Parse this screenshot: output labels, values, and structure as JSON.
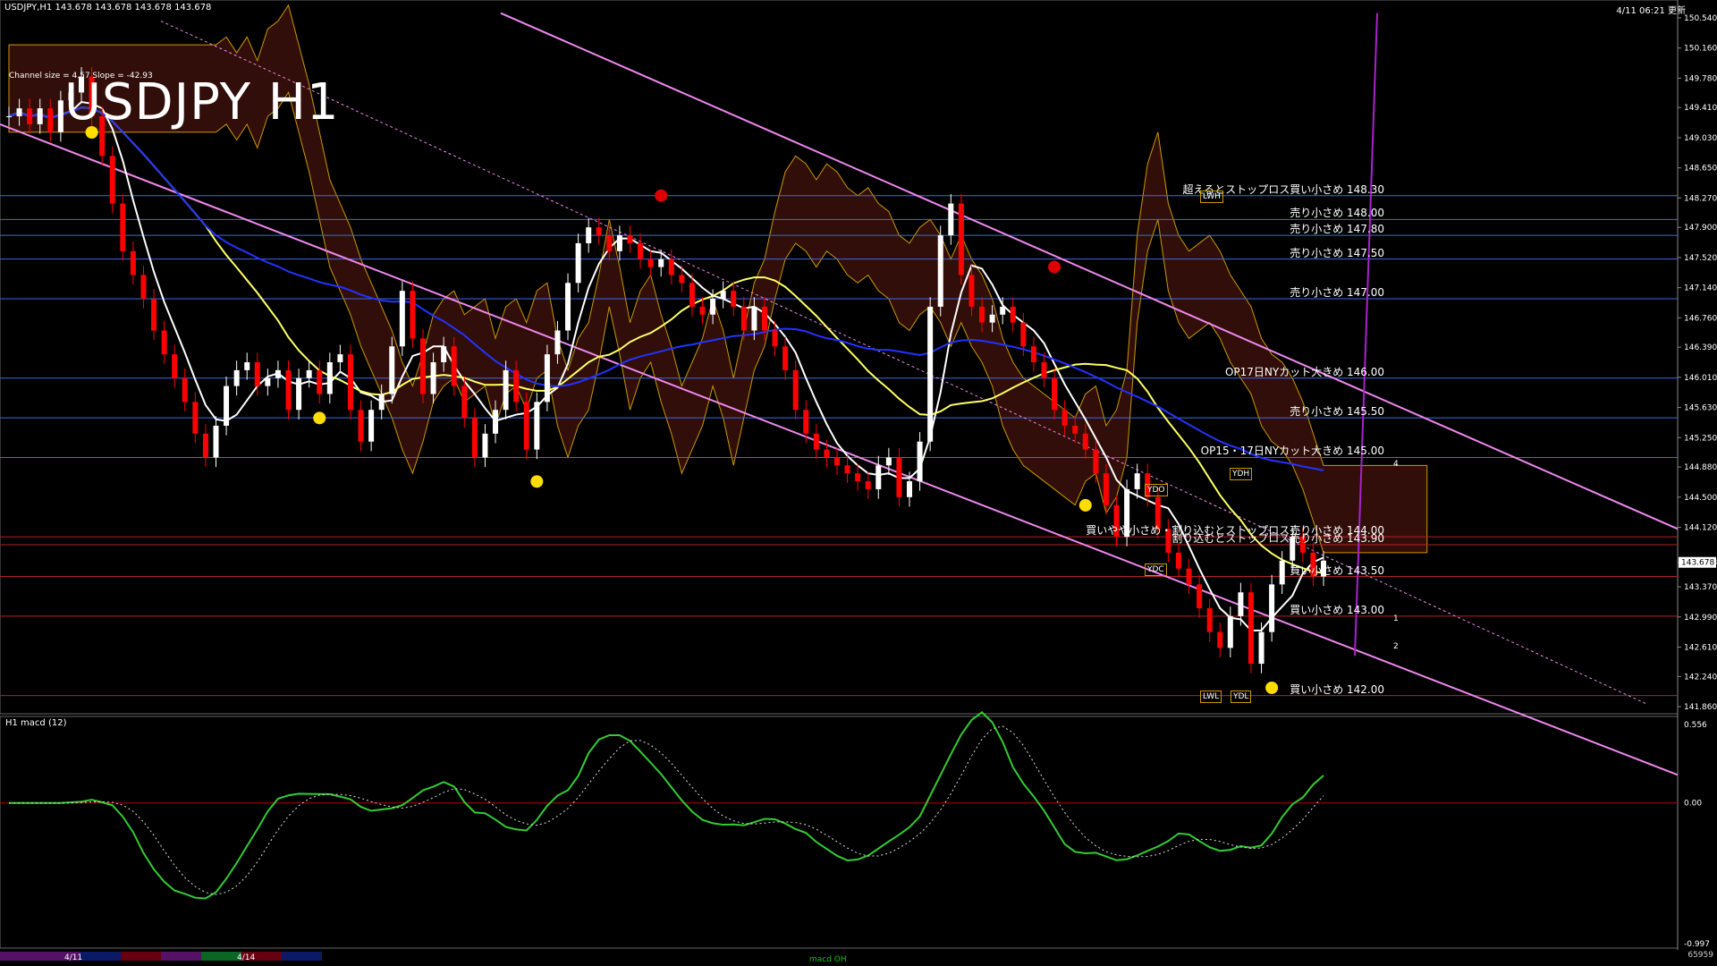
{
  "header": {
    "left": "USDJPY,H1  143.678 143.678 143.678 143.678",
    "right": "4/11 06:21 更新"
  },
  "main": {
    "big_title": "USDJPY H1",
    "channel_info": "Channel size = 4.57  Slope = -42.93"
  },
  "price_axis": [
    "150.540",
    "150.160",
    "149.780",
    "149.410",
    "149.030",
    "148.650",
    "148.270",
    "147.900",
    "147.520",
    "147.140",
    "146.760",
    "146.390",
    "146.010",
    "145.630",
    "145.250",
    "144.880",
    "144.500",
    "144.120",
    "143.678",
    "143.370",
    "142.990",
    "142.610",
    "142.240",
    "141.860"
  ],
  "current_price": "143.678",
  "annotations": [
    {
      "text": "超えるとストップロス買い小さめ 148.30",
      "price": 148.3,
      "color": "#4169e1"
    },
    {
      "text": "売り小さめ 148.00",
      "price": 148.0,
      "color": "#4169e1"
    },
    {
      "text": "売り小さめ 147.80",
      "price": 147.8,
      "color": "#4169e1"
    },
    {
      "text": "売り小さめ 147.50",
      "price": 147.5,
      "color": "#4169e1"
    },
    {
      "text": "売り小さめ 147.00",
      "price": 147.0,
      "color": "#4169e1"
    },
    {
      "text": "OP17日NYカット大きめ 146.00",
      "price": 146.0,
      "color": "#4169e1"
    },
    {
      "text": "売り小さめ 145.50",
      "price": 145.5,
      "color": "#4169e1"
    },
    {
      "text": "OP15・17日NYカット大きめ 145.00",
      "price": 145.0,
      "color": "#4169e1"
    },
    {
      "text": "買いやや小さめ・割り込むとストップロス売り小さめ 144.00",
      "price": 144.0,
      "color": "#b22222"
    },
    {
      "text": "割り込むとストップロス売り小さめ 143.90",
      "price": 143.9,
      "color": "#b22222"
    },
    {
      "text": "買い小さめ 143.50",
      "price": 143.5,
      "color": "#b22222"
    },
    {
      "text": "買い小さめ 143.00",
      "price": 143.0,
      "color": "#b22222"
    },
    {
      "text": "買い小さめ 142.00",
      "price": 142.0,
      "color": "#b22222"
    }
  ],
  "pivot_labels": [
    "YDO",
    "YDC",
    "YDH",
    "YDL",
    "LWH",
    "LWL"
  ],
  "projection_labels": [
    "1",
    "2",
    "4"
  ],
  "macd": {
    "title": "H1  macd (12)",
    "axis": [
      "0.556",
      "0.00",
      "-0.997"
    ],
    "footer": "macd OH"
  },
  "bottom": {
    "dates": [
      "4/11",
      "4/14"
    ],
    "right_number": "65959"
  },
  "colors": {
    "background": "#000000",
    "bull": "#ffffff",
    "bear": "#ff0000",
    "ma_fast": "#ffffff",
    "ma_mid": "#ffff66",
    "ma_slow": "#2233ff",
    "channel": "#ee88ee",
    "kumo": "#cc9900",
    "chikou": "#22cc22",
    "macd_up": "#33cc33",
    "macd_down": "#ee7799"
  },
  "chart_data": {
    "type": "candlestick",
    "symbol": "USDJPY",
    "timeframe": "H1",
    "ylim": [
      141.86,
      150.54
    ],
    "close_series": [
      149.3,
      149.4,
      149.2,
      149.4,
      149.1,
      149.5,
      149.6,
      149.8,
      149.3,
      148.8,
      148.2,
      147.6,
      147.3,
      147.0,
      146.6,
      146.3,
      146.0,
      145.7,
      145.3,
      145.0,
      145.4,
      145.9,
      146.1,
      146.2,
      145.9,
      146.0,
      146.1,
      145.6,
      146.0,
      146.1,
      145.8,
      146.2,
      146.3,
      145.6,
      145.2,
      145.6,
      145.8,
      146.4,
      147.1,
      146.5,
      145.8,
      146.2,
      146.4,
      145.9,
      145.5,
      145.0,
      145.3,
      145.6,
      146.1,
      145.7,
      145.1,
      145.7,
      146.3,
      146.6,
      147.2,
      147.7,
      147.9,
      147.8,
      147.6,
      147.8,
      147.7,
      147.5,
      147.4,
      147.5,
      147.3,
      147.2,
      146.9,
      146.8,
      147.0,
      147.1,
      146.9,
      146.6,
      146.9,
      146.6,
      146.4,
      146.1,
      145.6,
      145.3,
      145.1,
      145.0,
      144.9,
      144.8,
      144.7,
      144.6,
      144.9,
      145.0,
      144.5,
      144.7,
      145.2,
      146.9,
      147.8,
      148.2,
      147.3,
      146.9,
      146.7,
      146.8,
      146.9,
      146.7,
      146.4,
      146.2,
      146.0,
      145.6,
      145.4,
      145.3,
      145.1,
      144.8,
      144.4,
      144.0,
      144.6,
      144.8,
      144.5,
      144.1,
      143.8,
      143.6,
      143.4,
      143.1,
      142.8,
      142.6,
      143.0,
      143.3,
      142.4,
      142.8,
      143.4,
      143.7,
      144.0,
      143.8,
      143.5,
      143.7
    ]
  }
}
